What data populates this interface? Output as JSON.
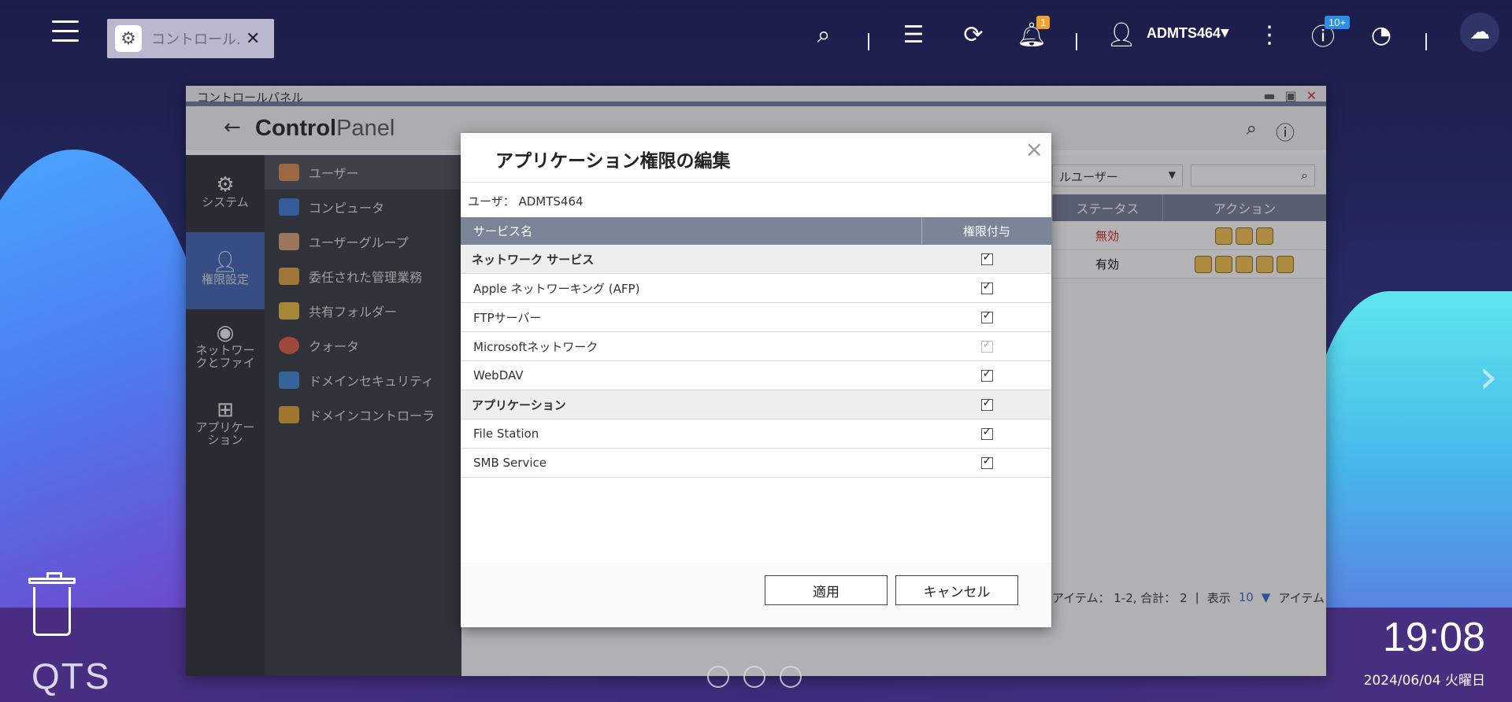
{
  "taskbar": {
    "tab_label": "コントロール...",
    "notification_badge": "1",
    "user_name": "ADMTS464",
    "update_badge": "10+"
  },
  "window": {
    "title": "コントロールパネル",
    "brand_bold": "Control",
    "brand_light": "Panel"
  },
  "left_nav": [
    {
      "label": "システム",
      "icon": "gear-icon"
    },
    {
      "label": "権限設定",
      "icon": "user-icon"
    },
    {
      "label": "ネットワー\nクとファイ",
      "icon": "globe-icon"
    },
    {
      "label": "アプリケー\nション",
      "icon": "grid-icon"
    }
  ],
  "sub_nav": [
    {
      "label": "ユーザー",
      "color": "#d98a4c"
    },
    {
      "label": "コンピュータ",
      "color": "#3a7bd5"
    },
    {
      "label": "ユーザーグループ",
      "color": "#d9a070"
    },
    {
      "label": "委任された管理業務",
      "color": "#e0a040"
    },
    {
      "label": "共有フォルダー",
      "color": "#e8b840"
    },
    {
      "label": "クォータ",
      "color": "#e05a40"
    },
    {
      "label": "ドメインセキュリティ",
      "color": "#3a86d0"
    },
    {
      "label": "ドメインコントローラ",
      "color": "#e0a030"
    }
  ],
  "bg_table": {
    "filter_value": "ルユーザー",
    "col_status": "ステータス",
    "col_action": "アクション",
    "rows": [
      {
        "status": "無効",
        "status_color": "#d02020"
      },
      {
        "status": "有効",
        "status_color": "#333333"
      }
    ],
    "footer_items": "アイテム： 1-2, 合計： 2",
    "footer_show": "表示",
    "footer_count": "10",
    "footer_unit": "アイテム"
  },
  "dialog": {
    "title": "アプリケーション権限の編集",
    "user_line": "ユーザ： ADMTS464",
    "col_service": "サービス名",
    "col_grant": "権限付与",
    "rows": [
      {
        "label": "ネットワーク サービス",
        "group": true,
        "checked": true,
        "disabled": false
      },
      {
        "label": "Apple ネットワーキング (AFP)",
        "group": false,
        "checked": true,
        "disabled": false
      },
      {
        "label": "FTPサーバー",
        "group": false,
        "checked": true,
        "disabled": false
      },
      {
        "label": "Microsoftネットワーク",
        "group": false,
        "checked": true,
        "disabled": true
      },
      {
        "label": "WebDAV",
        "group": false,
        "checked": true,
        "disabled": false
      },
      {
        "label": "アプリケーション",
        "group": true,
        "checked": true,
        "disabled": false
      },
      {
        "label": "File Station",
        "group": false,
        "checked": true,
        "disabled": false
      },
      {
        "label": "SMB Service",
        "group": false,
        "checked": true,
        "disabled": false
      }
    ],
    "apply_label": "適用",
    "cancel_label": "キャンセル"
  },
  "desktop": {
    "logo_text": "QTS",
    "time": "19:08",
    "date": "2024/06/04 火曜日"
  }
}
